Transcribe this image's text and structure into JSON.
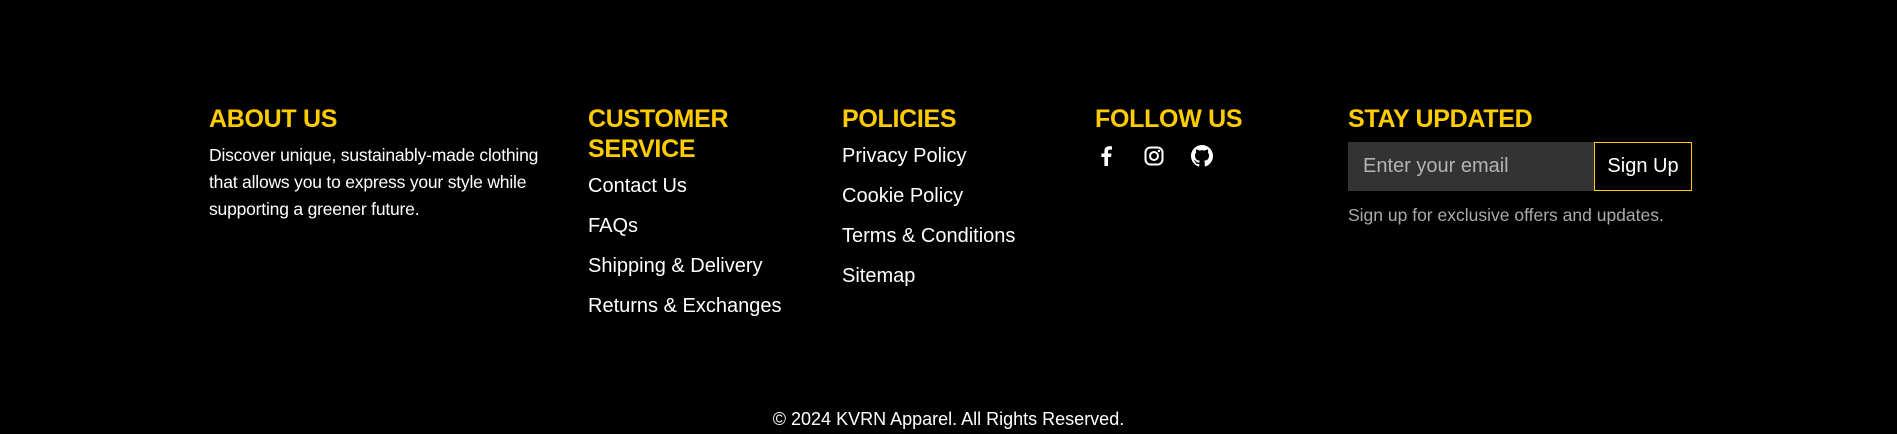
{
  "about": {
    "heading": "ABOUT US",
    "text": "Discover unique, sustainably-made clothing that allows you to express your style while supporting a greener future."
  },
  "service": {
    "heading": "CUSTOMER SERVICE",
    "links": [
      "Contact Us",
      "FAQs",
      "Shipping & Delivery",
      "Returns & Exchanges"
    ]
  },
  "policies": {
    "heading": "POLICIES",
    "links": [
      "Privacy Policy",
      "Cookie Policy",
      "Terms & Conditions",
      "Sitemap"
    ]
  },
  "follow": {
    "heading": "FOLLOW US",
    "icons": [
      "facebook-icon",
      "instagram-icon",
      "github-icon"
    ]
  },
  "stay": {
    "heading": "STAY UPDATED",
    "email_placeholder": "Enter your email",
    "button_label": "Sign Up",
    "note": "Sign up for exclusive offers and updates."
  },
  "copyright": "© 2024 KVRN Apparel. All Rights Reserved.",
  "colors": {
    "background": "#000000",
    "accent": "#ffcc00",
    "input_bg": "#333333",
    "muted_text": "#aaaaaa"
  }
}
